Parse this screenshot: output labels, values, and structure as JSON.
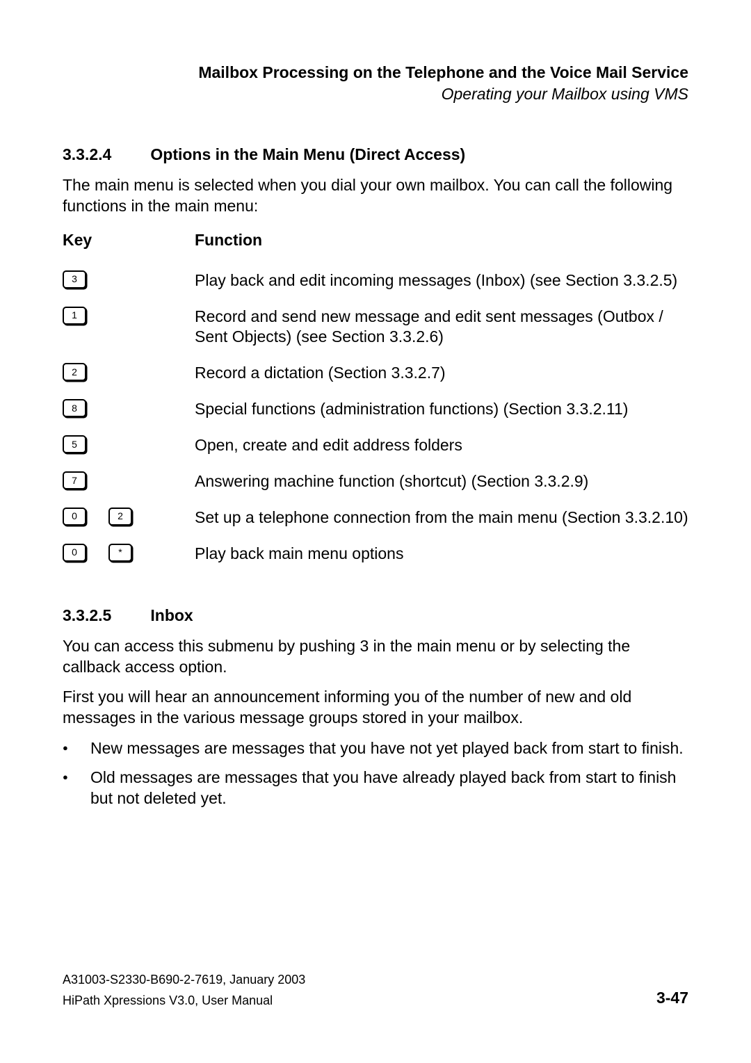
{
  "header": {
    "title": "Mailbox Processing on the Telephone and the Voice Mail Service",
    "subtitle": "Operating your Mailbox using VMS"
  },
  "section1": {
    "number": "3.3.2.4",
    "title": "Options in the Main Menu (Direct Access)",
    "intro": "The main menu is selected when you dial your own mailbox. You can call the following functions in the main menu:",
    "table": {
      "head_key": "Key",
      "head_function": "Function",
      "rows": [
        {
          "keys": [
            "3"
          ],
          "func": "Play back and edit incoming messages (Inbox) (see Section 3.3.2.5)"
        },
        {
          "keys": [
            "1"
          ],
          "func": "Record and send new message and edit sent messages (Outbox / Sent Objects) (see Section 3.3.2.6)"
        },
        {
          "keys": [
            "2"
          ],
          "func": "Record a dictation (Section 3.3.2.7)"
        },
        {
          "keys": [
            "8"
          ],
          "func": "Special functions (administration functions) (Section 3.3.2.11)"
        },
        {
          "keys": [
            "5"
          ],
          "func": "Open, create and edit address folders"
        },
        {
          "keys": [
            "7"
          ],
          "func": "Answering machine function (shortcut) (Section 3.3.2.9)"
        },
        {
          "keys": [
            "0",
            "2"
          ],
          "func": "Set up a telephone connection from the main menu (Section 3.3.2.10)"
        },
        {
          "keys": [
            "0",
            "*"
          ],
          "func": "Play back main menu options"
        }
      ]
    }
  },
  "section2": {
    "number": "3.3.2.5",
    "title": "Inbox",
    "para1": "You can access this submenu by pushing 3 in the main menu or by selecting the callback access option.",
    "para2": "First you will hear an announcement informing you of the number of new and old messages in the various message groups stored in your mailbox.",
    "bullets": [
      "New messages are messages that you have not yet played back from start to finish.",
      "Old messages are messages that you have already played back from start to finish but not deleted yet."
    ]
  },
  "footer": {
    "line1": "A31003-S2330-B690-2-7619, January 2003",
    "line2": "HiPath Xpressions V3.0, User Manual",
    "page": "3-47"
  }
}
